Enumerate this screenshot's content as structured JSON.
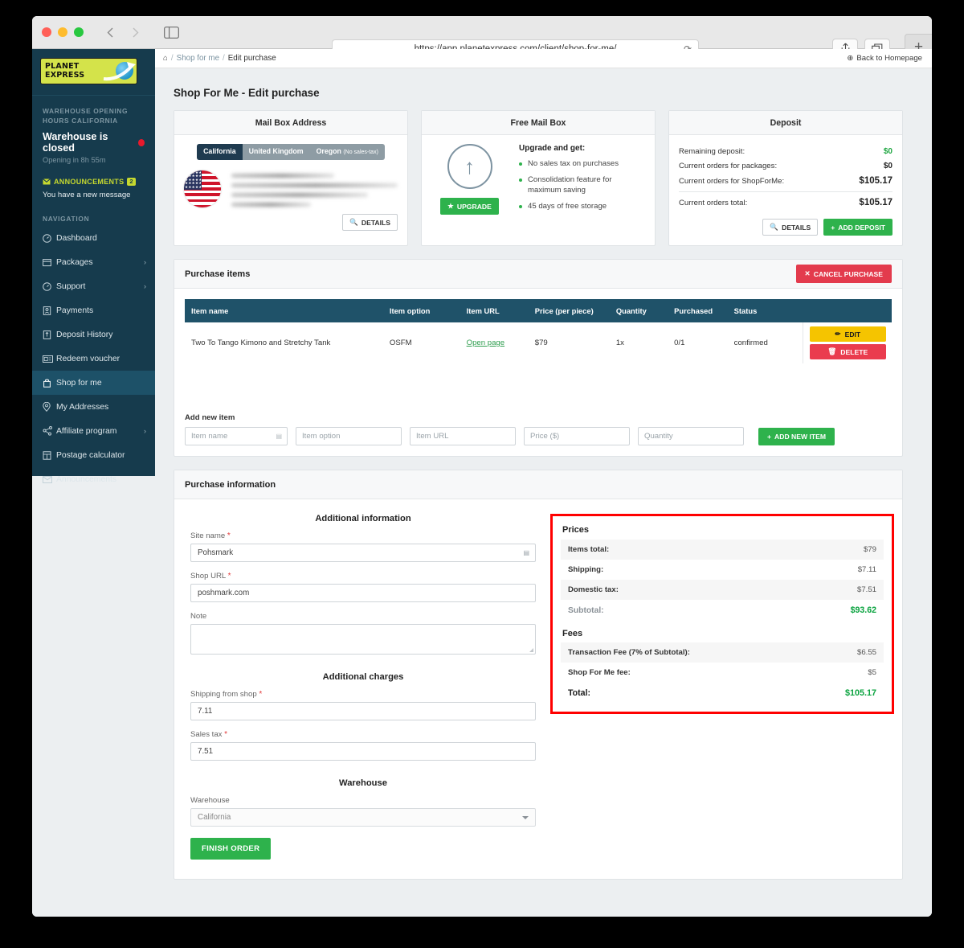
{
  "browser": {
    "url": "https://app.planetexpress.com/client/shop-for-me/",
    "reload_icon": "reload-icon",
    "back_icon": "chevron-left-icon",
    "forward_icon": "chevron-right-icon",
    "sidebar_icon": "sidebar-toggle-icon",
    "share_icon": "share-icon",
    "tabs_icon": "tab-overview-icon",
    "newtab_label": "+"
  },
  "sidebar": {
    "logo": {
      "line1": "PLANET",
      "line2": "EXPRESS"
    },
    "warehouse_hours_head": "WAREHOUSE OPENING HOURS CALIFORNIA",
    "warehouse_status": "Warehouse is closed",
    "warehouse_sub": "Opening in 8h 55m",
    "announcements_head": "ANNOUNCEMENTS",
    "announcements_badge": "2",
    "announcements_msg": "You have a new message",
    "nav_head": "NAVIGATION",
    "items": [
      {
        "label": "Dashboard",
        "icon": "dashboard-icon",
        "caret": false,
        "active": false
      },
      {
        "label": "Packages",
        "icon": "box-icon",
        "caret": true,
        "active": false
      },
      {
        "label": "Support",
        "icon": "support-icon",
        "caret": true,
        "active": false
      },
      {
        "label": "Payments",
        "icon": "payments-icon",
        "caret": false,
        "active": false
      },
      {
        "label": "Deposit History",
        "icon": "deposit-icon",
        "caret": false,
        "active": false
      },
      {
        "label": "Redeem voucher",
        "icon": "voucher-icon",
        "caret": false,
        "active": false
      },
      {
        "label": "Shop for me",
        "icon": "bag-icon",
        "caret": false,
        "active": true
      },
      {
        "label": "My Addresses",
        "icon": "map-pin-icon",
        "caret": false,
        "active": false
      },
      {
        "label": "Affiliate program",
        "icon": "share-node-icon",
        "caret": true,
        "active": false
      },
      {
        "label": "Postage calculator",
        "icon": "calculator-icon",
        "caret": false,
        "active": false
      },
      {
        "label": "Announcements",
        "icon": "envelope-icon",
        "caret": false,
        "active": false
      }
    ]
  },
  "breadcrumb": {
    "home_icon": "home-icon",
    "sep1": "/",
    "link": "Shop for me",
    "sep2": "/",
    "current": "Edit purchase",
    "back_home": "Back to Homepage",
    "back_home_icon": "globe-icon"
  },
  "page_title": "Shop For Me - Edit purchase",
  "mailbox_card": {
    "title": "Mail Box Address",
    "tabs": [
      {
        "label": "California",
        "sub": "",
        "selected": true
      },
      {
        "label": "United Kingdom",
        "sub": "",
        "selected": false
      },
      {
        "label": "Oregon",
        "sub": "(No sales-tax)",
        "selected": false
      }
    ],
    "flag_icon": "us-flag-icon",
    "details_label": "DETAILS",
    "details_icon": "search-icon"
  },
  "freemailbox_card": {
    "title": "Free Mail Box",
    "arrow_icon": "arrow-up-circle-icon",
    "upgrade_label": "UPGRADE",
    "upgrade_icon": "star-icon",
    "subtitle": "Upgrade and get:",
    "benefits": [
      "No sales tax on purchases",
      "Consolidation feature for maximum saving",
      "45 days of free storage"
    ]
  },
  "deposit_card": {
    "title": "Deposit",
    "rows": [
      {
        "label": "Remaining deposit:",
        "value": "$0",
        "green": true
      },
      {
        "label": "Current orders for packages:",
        "value": "$0",
        "green": false
      },
      {
        "label": "Current orders for ShopForMe:",
        "value": "$105.17",
        "green": false
      }
    ],
    "total_label": "Current orders total:",
    "total_value": "$105.17",
    "details_label": "DETAILS",
    "details_icon": "search-icon",
    "add_deposit_label": "ADD DEPOSIT",
    "add_deposit_icon": "plus-icon"
  },
  "purchase_items": {
    "title": "Purchase items",
    "cancel_label": "CANCEL PURCHASE",
    "cancel_icon": "close-icon",
    "columns": [
      "Item name",
      "Item option",
      "Item URL",
      "Price (per piece)",
      "Quantity",
      "Purchased",
      "Status"
    ],
    "rows": [
      {
        "name": "Two To Tango Kimono and Stretchy Tank",
        "option": "OSFM",
        "url_label": "Open page",
        "price": "$79",
        "quantity": "1x",
        "purchased": "0/1",
        "status": "confirmed",
        "edit_label": "EDIT",
        "edit_icon": "pencil-icon",
        "delete_label": "DELETE",
        "delete_icon": "trash-icon"
      }
    ],
    "add_new_label": "Add new item",
    "add_fields": [
      {
        "placeholder": "Item name",
        "trail_icon": "clipboard-icon"
      },
      {
        "placeholder": "Item option",
        "trail_icon": ""
      },
      {
        "placeholder": "Item URL",
        "trail_icon": ""
      },
      {
        "placeholder": "Price ($)",
        "trail_icon": ""
      },
      {
        "placeholder": "Quantity",
        "trail_icon": ""
      }
    ],
    "add_button_label": "ADD NEW ITEM",
    "add_button_icon": "plus-icon"
  },
  "purchase_information": {
    "title": "Purchase information",
    "additional_information_title": "Additional information",
    "site_name_label": "Site name",
    "site_name_value": "Pohsmark",
    "site_name_trail_icon": "clipboard-icon",
    "shop_url_label": "Shop URL",
    "shop_url_value": "poshmark.com",
    "note_label": "Note",
    "note_value": "",
    "additional_charges_title": "Additional charges",
    "shipping_from_shop_label": "Shipping from shop",
    "shipping_from_shop_value": "7.11",
    "sales_tax_label": "Sales tax",
    "sales_tax_value": "7.51",
    "warehouse_title": "Warehouse",
    "warehouse_label": "Warehouse",
    "warehouse_value": "California",
    "finish_label": "FINISH ORDER",
    "required_marker": "*"
  },
  "prices": {
    "prices_head": "Prices",
    "rows": [
      {
        "label": "Items total:",
        "value": "$79"
      },
      {
        "label": "Shipping:",
        "value": "$7.11"
      },
      {
        "label": "Domestic tax:",
        "value": "$7.51"
      }
    ],
    "subtotal_label": "Subtotal:",
    "subtotal_value": "$93.62",
    "fees_head": "Fees",
    "fee_rows": [
      {
        "label": "Transaction Fee (7% of Subtotal):",
        "value": "$6.55"
      },
      {
        "label": "Shop For Me fee:",
        "value": "$5"
      }
    ],
    "total_label": "Total:",
    "total_value": "$105.17",
    "highlight_color": "#ff0000",
    "accent_green": "#0aa33f"
  }
}
